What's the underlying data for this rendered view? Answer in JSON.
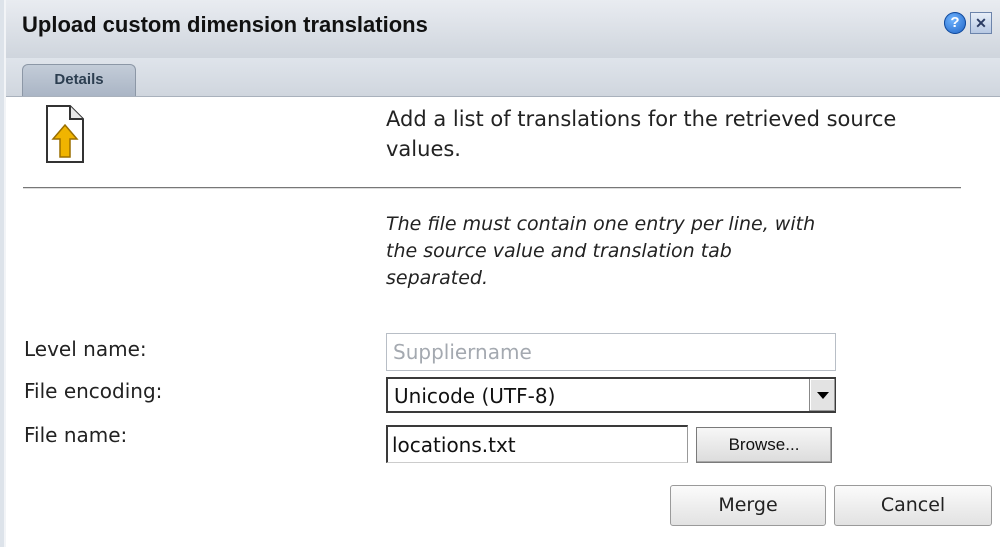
{
  "dialog": {
    "title": "Upload custom dimension translations",
    "help_icon_glyph": "?",
    "close_icon_glyph": "✕"
  },
  "tabs": [
    {
      "label": "Details",
      "active": true
    }
  ],
  "content": {
    "icon": "upload-file-icon",
    "intro": "Add a list of translations for the retrieved source values.",
    "note": "The file must contain one entry per line, with the source value and translation tab separated."
  },
  "form": {
    "level_name": {
      "label": "Level name:",
      "value": "Suppliername"
    },
    "file_encoding": {
      "label": "File encoding:",
      "value": "Unicode (UTF-8)"
    },
    "file_name": {
      "label": "File name:",
      "value": "locations.txt",
      "browse_label": "Browse..."
    }
  },
  "footer": {
    "merge_label": "Merge",
    "cancel_label": "Cancel"
  },
  "colors": {
    "accent_blue": "#1b5fc2",
    "titlebar_bg": "#dfe3e9",
    "tab_bg": "#b5bfcd",
    "icon_arrow": "#f0b400"
  }
}
